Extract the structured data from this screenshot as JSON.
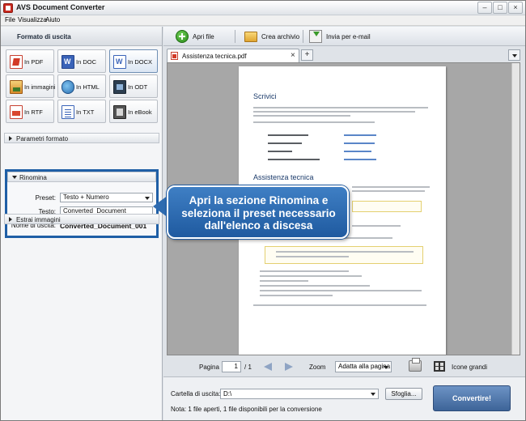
{
  "window": {
    "title": "AVS Document Converter"
  },
  "menu": {
    "file": "File",
    "view": "Visualizza",
    "help": "Aiuto"
  },
  "left": {
    "title": "Formato di uscita",
    "formats": [
      {
        "label": "In PDF"
      },
      {
        "label": "In DOC"
      },
      {
        "label": "In DOCX"
      },
      {
        "label": "In immagini"
      },
      {
        "label": "In HTML"
      },
      {
        "label": "In ODT"
      },
      {
        "label": "In RTF"
      },
      {
        "label": "In TXT"
      },
      {
        "label": "In eBook"
      }
    ],
    "selected_format": "In DOCX",
    "sections": {
      "params": "Parametri formato",
      "rename": "Rinomina",
      "extract": "Estrai immagini"
    },
    "rename": {
      "preset_label": "Preset:",
      "preset_value": "Testo + Numero",
      "text_label": "Testo:",
      "text_value": "Converted_Document",
      "output_name_label": "Nome di uscita:",
      "output_name_value": "Converted_Document_001"
    }
  },
  "toolbar": {
    "open": "Apri file",
    "archive": "Crea archivio",
    "email": "Invia per e-mail"
  },
  "tabs": {
    "doc_tab": "Assistenza tecnica.pdf",
    "close": "×",
    "add": "+"
  },
  "callout": {
    "text": "Apri la sezione Rinomina e seleziona il preset necessario dall'elenco a discesa"
  },
  "page_preview": {
    "heading_1": "Scrivici",
    "heading_2": "Assistenza tecnica"
  },
  "nav": {
    "page_label": "Pagina",
    "page_value": "1",
    "page_total": "/ 1",
    "zoom_label": "Zoom",
    "zoom_value": "Adatta alla pagina",
    "thumbs_label": "Icone grandi"
  },
  "bottom": {
    "folder_label": "Cartella di uscita:",
    "folder_value": "D:\\",
    "browse": "Sfoglia...",
    "convert": "Convertire!",
    "note": "Nota: 1 file aperti, 1 file disponibili per la conversione"
  },
  "colors": {
    "accent": "#1f5fa6",
    "callout": "#2e6bb0",
    "convert_button": "#4a72a8"
  }
}
